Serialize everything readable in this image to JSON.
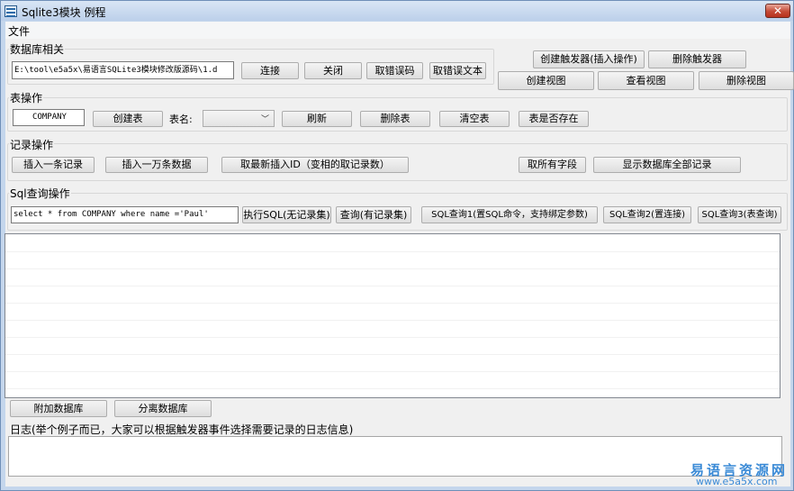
{
  "window": {
    "title": "Sqlite3模块 例程",
    "close_label": "✕"
  },
  "menu": {
    "file": "文件"
  },
  "db_group": {
    "label": "数据库相关",
    "path_value": "E:\\tool\\e5a5x\\易语言SQLite3模块修改版源码\\1.d",
    "connect": "连接",
    "close": "关闭",
    "get_error_code": "取错误码",
    "get_error_text": "取错误文本"
  },
  "trigger": {
    "create": "创建触发器(插入操作)",
    "delete": "删除触发器"
  },
  "view": {
    "create": "创建视图",
    "view": "查看视图",
    "delete": "删除视图"
  },
  "table_group": {
    "label": "表操作",
    "table_value": "COMPANY",
    "create": "创建表",
    "name_label": "表名:",
    "combo_value": "",
    "refresh": "刷新",
    "delete": "删除表",
    "clear": "清空表",
    "exists": "表是否存在"
  },
  "record_group": {
    "label": "记录操作",
    "insert_one": "插入一条记录",
    "insert_10k": "插入一万条数据",
    "last_insert": "取最新插入ID（变相的取记录数）",
    "get_fields": "取所有字段",
    "show_all": "显示数据库全部记录"
  },
  "sql_group": {
    "label": "Sql查询操作",
    "sql_value": "select * from COMPANY where name ='Paul'",
    "exec": "执行SQL(无记录集)",
    "query": "查询(有记录集)",
    "q1": "SQL查询1(置SQL命令，支持绑定参数)",
    "q2": "SQL查询2(置连接)",
    "q3": "SQL查询3(表查询)"
  },
  "attach": {
    "attach": "附加数据库",
    "detach": "分离数据库"
  },
  "log": {
    "label": "日志(举个例子而已，大家可以根据触发器事件选择需要记录的日志信息)"
  },
  "watermark": {
    "brand": "易语言资源网",
    "url": "www.e5a5x.com"
  },
  "colors": {
    "accent": "#3a8ad6",
    "close": "#c54a36"
  }
}
